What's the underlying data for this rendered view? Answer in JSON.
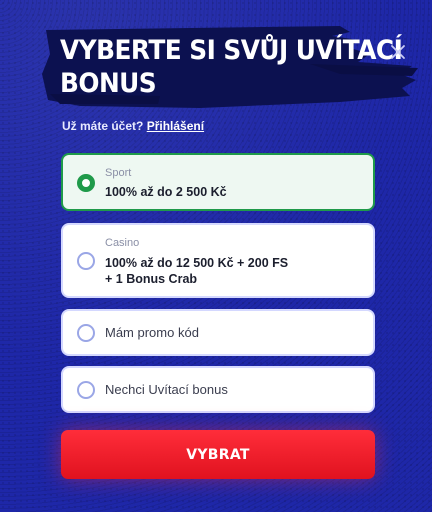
{
  "header": {
    "title_line1": "VYBERTE SI SVŮJ UVÍTACÍ",
    "title_line2": "BONUS",
    "close_icon": "close-icon"
  },
  "login": {
    "prompt": "Už máte účet?",
    "link_label": "Přihlášení"
  },
  "options": [
    {
      "category": "Sport",
      "text": "100% až do 2 500 Kč",
      "selected": true
    },
    {
      "category": "Casino",
      "text_line1": "100% až do 12 500 Kč + 200 FS",
      "text_line2": "+ 1 Bonus Crab",
      "selected": false
    },
    {
      "text": "Mám promo kód",
      "selected": false
    },
    {
      "text": "Nechci Uvítací bonus",
      "selected": false
    }
  ],
  "cta": {
    "label": "VYBRAT"
  },
  "colors": {
    "background": "#1e27a8",
    "brush": "#0c1150",
    "selected_border": "#1f9a4a",
    "cta": "#e0121f"
  }
}
